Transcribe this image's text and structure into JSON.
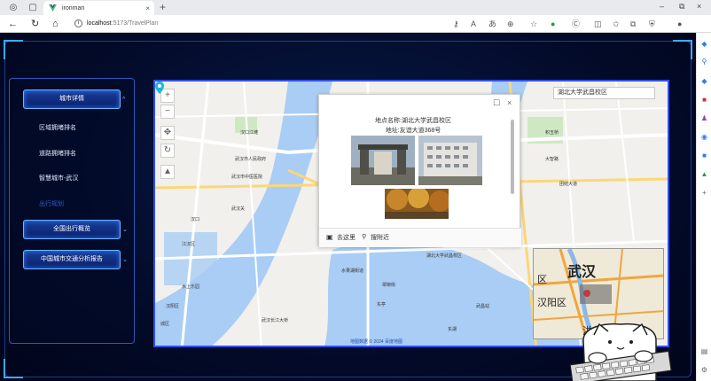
{
  "browser": {
    "tab_title": "ironman",
    "tab_close": "×",
    "new_tab": "+",
    "url_host": "localhost",
    "url_path": ":5173/TravelPlan",
    "win_min": "–",
    "win_max": "⧉",
    "win_close": "×"
  },
  "menu": {
    "city_detail": "城市详情",
    "sub_items": [
      "区域拥堵排名",
      "道路拥堵排名",
      "智慧城市-武汉",
      "出行规划"
    ],
    "national_overview": "全国出行概览",
    "report": "中国城市交通分析报告"
  },
  "map": {
    "search_value": "湖北大学武昌校区",
    "popup_name": "地点名称:湖北大学武昌校区",
    "popup_addr": "地址:友谊大道368号",
    "popup_street_view": "去这里",
    "popup_search_near": "搜附近",
    "copyright": "地图数据 © 2024 百度地图",
    "labels": [
      "武汉市人民政府",
      "武汉市中医医院",
      "江汉区",
      "汉口",
      "武汉关",
      "湖北大学武昌校区",
      "水果湖街道",
      "翠柳街",
      "团结大道",
      "积玉桥",
      "水上乐园",
      "汉阳区",
      "武昌站",
      "东湖",
      "城区",
      "东亭",
      "汉口江滩",
      "大智路",
      "武汉长江大桥"
    ],
    "mini_city": "武汉",
    "mini_district": "汉阳区",
    "mini_district2": "区",
    "mini_bottom": "洪山"
  }
}
